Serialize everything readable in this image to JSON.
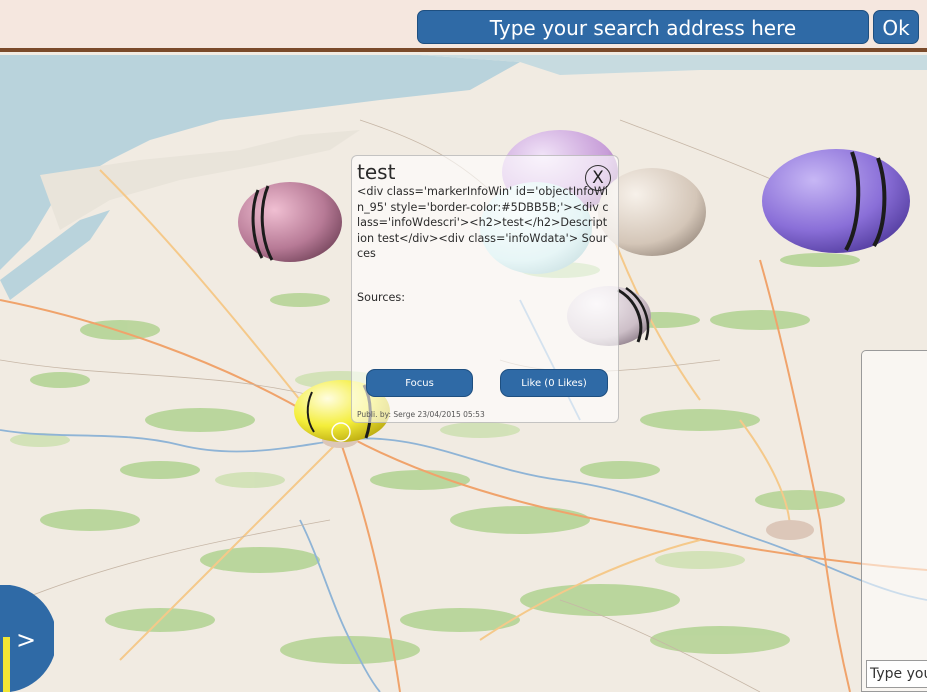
{
  "search": {
    "placeholder": "Type your search address here",
    "ok_label": "Ok"
  },
  "info_window": {
    "title": "test",
    "close_label": "X",
    "raw_html": "<div class='markerInfoWin' id='objectInfoWin_95' style='border-color:#5DBB5B;'><div class='infoWdescri'><h2>test</h2>Description test</div><div class='infoWdata'> Sources",
    "sources_label": "Sources:",
    "focus_label": "Focus",
    "like_label": "Like (0 Likes)",
    "published": "Publi. by: Serge 23/04/2015 05:53"
  },
  "side_panel": {
    "input_placeholder": "Type your"
  },
  "open_panel": {
    "icon": "chevron-right-icon",
    "label": ">"
  },
  "colors": {
    "accent": "#2f6aa6",
    "topbar": "#f5e7df",
    "topbar_border": "#7a4a2a",
    "panel_yellow": "#f1e634"
  }
}
